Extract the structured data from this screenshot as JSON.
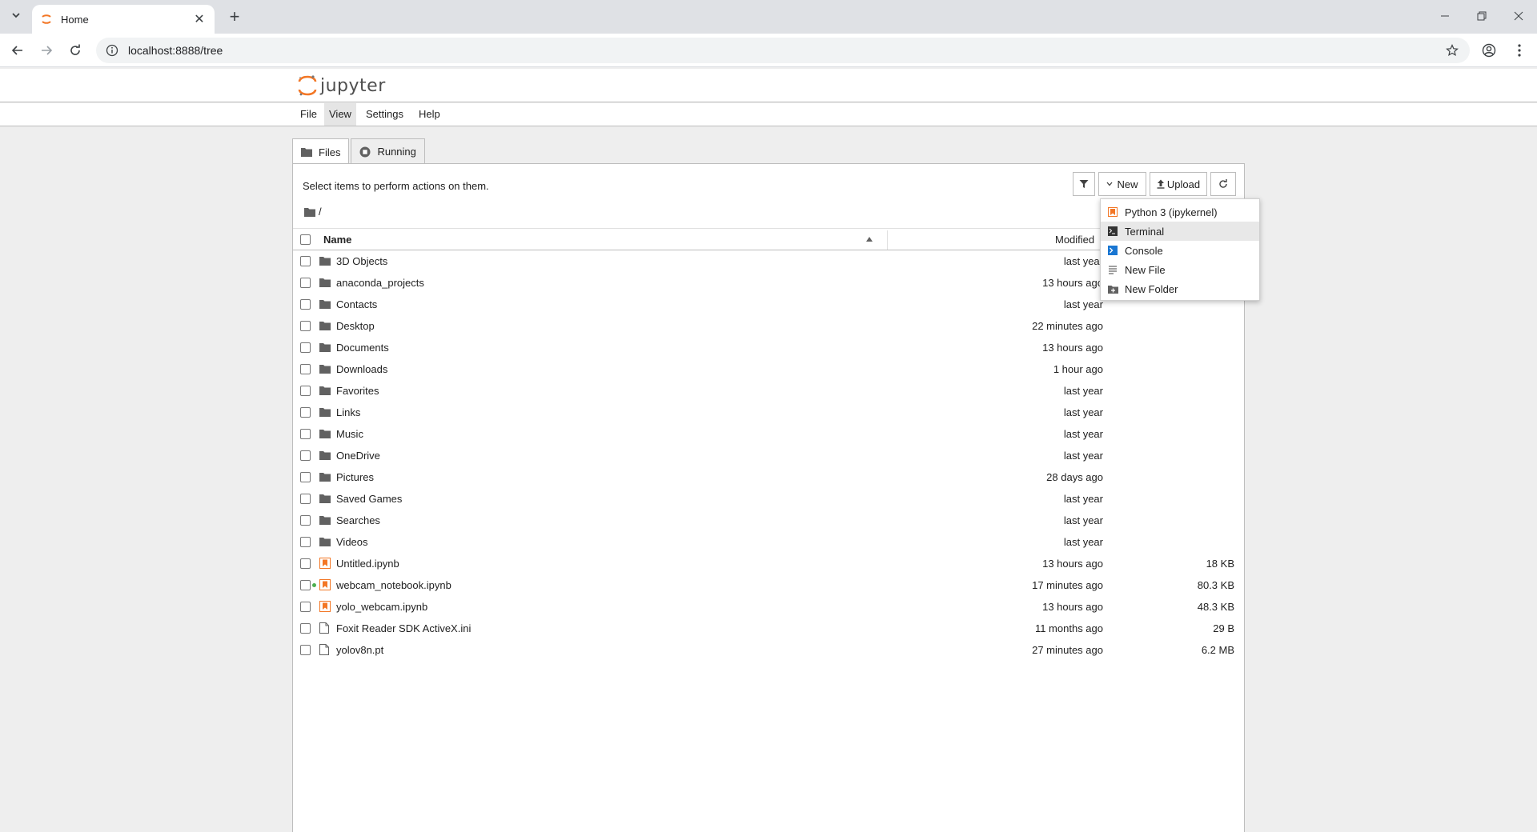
{
  "browser": {
    "tab_title": "Home",
    "url": "localhost:8888/tree"
  },
  "jupyter": {
    "logo_text": "jupyter",
    "menu": [
      "File",
      "View",
      "Settings",
      "Help"
    ],
    "tabs": [
      {
        "label": "Files",
        "icon": "folder-icon"
      },
      {
        "label": "Running",
        "icon": "running-icon"
      }
    ],
    "hint": "Select items to perform actions on them.",
    "toolbar": {
      "filter_icon": "filter-icon",
      "new_label": "New",
      "upload_label": "Upload",
      "refresh_icon": "refresh-icon"
    },
    "breadcrumb": "/",
    "columns": {
      "name": "Name",
      "modified": "Modified"
    },
    "files": [
      {
        "name": "3D Objects",
        "type": "folder",
        "modified": "last year",
        "size": ""
      },
      {
        "name": "anaconda_projects",
        "type": "folder",
        "modified": "13 hours ago",
        "size": ""
      },
      {
        "name": "Contacts",
        "type": "folder",
        "modified": "last year",
        "size": ""
      },
      {
        "name": "Desktop",
        "type": "folder",
        "modified": "22 minutes ago",
        "size": ""
      },
      {
        "name": "Documents",
        "type": "folder",
        "modified": "13 hours ago",
        "size": ""
      },
      {
        "name": "Downloads",
        "type": "folder",
        "modified": "1 hour ago",
        "size": ""
      },
      {
        "name": "Favorites",
        "type": "folder",
        "modified": "last year",
        "size": ""
      },
      {
        "name": "Links",
        "type": "folder",
        "modified": "last year",
        "size": ""
      },
      {
        "name": "Music",
        "type": "folder",
        "modified": "last year",
        "size": ""
      },
      {
        "name": "OneDrive",
        "type": "folder",
        "modified": "last year",
        "size": ""
      },
      {
        "name": "Pictures",
        "type": "folder",
        "modified": "28 days ago",
        "size": ""
      },
      {
        "name": "Saved Games",
        "type": "folder",
        "modified": "last year",
        "size": ""
      },
      {
        "name": "Searches",
        "type": "folder",
        "modified": "last year",
        "size": ""
      },
      {
        "name": "Videos",
        "type": "folder",
        "modified": "last year",
        "size": ""
      },
      {
        "name": "Untitled.ipynb",
        "type": "notebook",
        "modified": "13 hours ago",
        "size": "18 KB"
      },
      {
        "name": "webcam_notebook.ipynb",
        "type": "notebook",
        "running": true,
        "modified": "17 minutes ago",
        "size": "80.3 KB"
      },
      {
        "name": "yolo_webcam.ipynb",
        "type": "notebook",
        "modified": "13 hours ago",
        "size": "48.3 KB"
      },
      {
        "name": "Foxit Reader SDK ActiveX.ini",
        "type": "file",
        "modified": "11 months ago",
        "size": "29 B"
      },
      {
        "name": "yolov8n.pt",
        "type": "file",
        "modified": "27 minutes ago",
        "size": "6.2 MB"
      }
    ],
    "new_menu": [
      {
        "label": "Python 3 (ipykernel)",
        "icon": "notebook-icon"
      },
      {
        "label": "Terminal",
        "icon": "terminal-icon"
      },
      {
        "label": "Console",
        "icon": "console-icon"
      },
      {
        "label": "New File",
        "icon": "text-file-icon"
      },
      {
        "label": "New Folder",
        "icon": "new-folder-icon"
      }
    ]
  }
}
